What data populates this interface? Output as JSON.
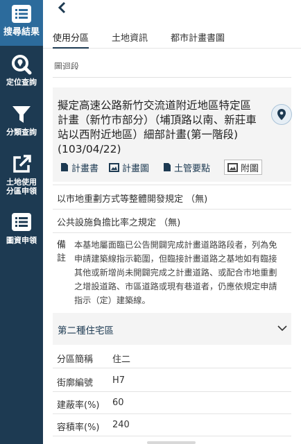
{
  "sidebar": {
    "items": [
      {
        "label_line1": "搜尋結果",
        "label_line2": "",
        "icon": "list-icon",
        "active": true
      },
      {
        "label_line1": "定位查詢",
        "label_line2": "",
        "icon": "search-location-icon",
        "active": false
      },
      {
        "label_line1": "分類查詢",
        "label_line2": "",
        "icon": "filter-icon",
        "active": false
      },
      {
        "label_line1": "土地使用",
        "label_line2": "分區申領",
        "icon": "external-link-icon",
        "active": false
      },
      {
        "label_line1": "圖資申領",
        "label_line2": "",
        "icon": "list-icon",
        "active": false
      }
    ],
    "bg_color": "#1d3a52",
    "active_color": "#2c6b9c"
  },
  "header": {
    "back_icon": "chevron-left-icon",
    "tabs": [
      {
        "label": "使用分區",
        "active": true
      },
      {
        "label": "土地資訊",
        "active": false
      },
      {
        "label": "都市計畫書圖",
        "active": false
      }
    ]
  },
  "cut_text": "圖迴段",
  "plan": {
    "title": "擬定高速公路新竹交流道附近地區特定區計畫（新竹市部分）（埔頂路以南、新莊車站以西附近地區）細部計畫(第一階段)(103/04/22)",
    "pin_icon": "map-marker-icon",
    "links": [
      {
        "label": "計畫書",
        "icon": "file-icon"
      },
      {
        "label": "計畫圖",
        "icon": "image-icon"
      },
      {
        "label": "土管要點",
        "icon": "file-icon"
      },
      {
        "label": "附圖",
        "icon": "image-icon"
      }
    ]
  },
  "rules": [
    {
      "text": "以市地重劃方式等整體開發規定 （無)"
    },
    {
      "text": "公共設施負擔比率之規定 （無)"
    }
  ],
  "note": {
    "label": "備註",
    "text": "本基地屬面臨已公告開闢完成計畫道路路段者，列為免申請建築線指示範圍，但臨接計畫道路之基地如有臨接其他或新增尚未開闢完成之計畫道路、或配合市地重劃之增設道路、市區道路或現有巷道者，仍應依規定申請指示（定）建築線。"
  },
  "zone": {
    "title": "第二種住宅區",
    "chevron_icon": "chevron-down-icon",
    "fields": [
      {
        "label": "分區簡稱",
        "value": "住二"
      },
      {
        "label": "街廓編號",
        "value": "H7"
      },
      {
        "label": "建蔽率(%)",
        "value": "60"
      },
      {
        "label": "容積率(%)",
        "value": "240"
      }
    ]
  }
}
